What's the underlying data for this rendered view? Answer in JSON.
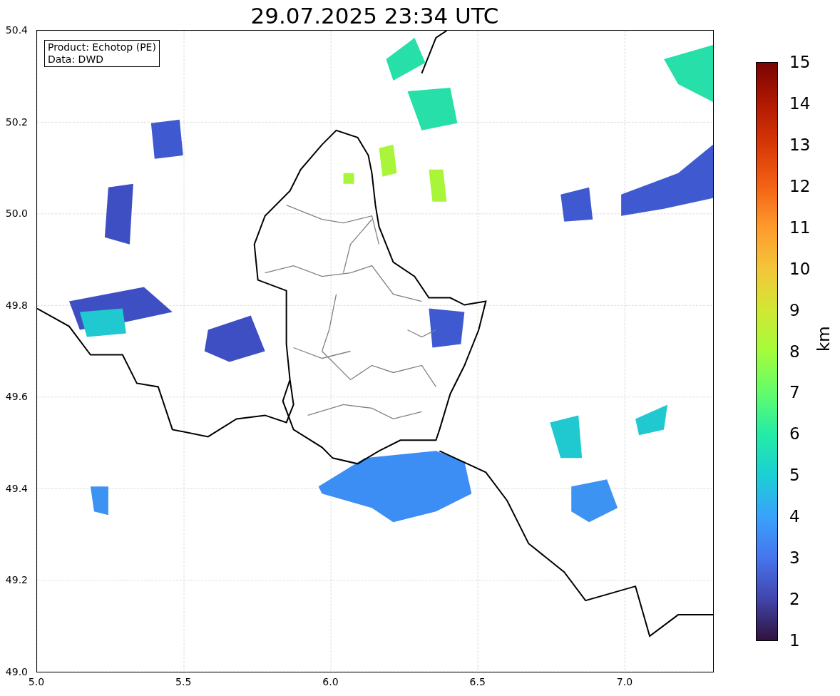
{
  "title": "29.07.2025 23:34 UTC",
  "info_box": {
    "lines": [
      "Product: Echotop (PE)",
      "Data: DWD"
    ]
  },
  "map": {
    "x_ticks": [
      "5.0",
      "5.5",
      "6.0",
      "6.5",
      "7.0"
    ],
    "y_ticks": [
      "50.4",
      "50.2",
      "50.0",
      "49.8",
      "49.6",
      "49.4",
      "49.2",
      "49.0"
    ]
  },
  "colorbar": {
    "label": "km",
    "ticks": [
      "15",
      "14",
      "13",
      "12",
      "11",
      "10",
      "9",
      "8",
      "7",
      "6",
      "5",
      "4",
      "3",
      "2",
      "1"
    ]
  }
}
